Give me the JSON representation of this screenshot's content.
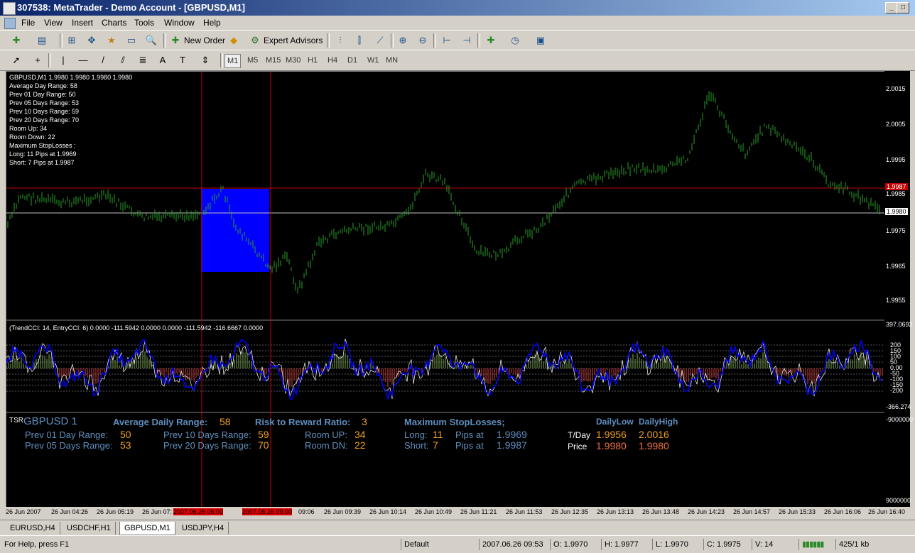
{
  "window": {
    "title": "307538: MetaTrader - Demo Account - [GBPUSD,M1]"
  },
  "menu": [
    "File",
    "View",
    "Insert",
    "Charts",
    "Tools",
    "Window",
    "Help"
  ],
  "toolbar": {
    "new_order": "New Order",
    "expert_advisors": "Expert Advisors"
  },
  "timeframes": [
    "M1",
    "M5",
    "M15",
    "M30",
    "H1",
    "H4",
    "D1",
    "W1",
    "MN"
  ],
  "chart": {
    "header": "GBPUSD,M1  1.9980 1.9980 1.9980 1.9980",
    "info_lines": [
      "Average Day  Range: 58",
      "Prev 01  Day  Range: 50",
      "Prev 05  Days Range: 53",
      "Prev 10  Days Range: 59",
      "Prev 20  Days Range: 70",
      "Room Up:    34",
      "Room Down: 22",
      "Maximum StopLosses :",
      "Long:  11 Pips at 1.9969",
      "Short: 7 Pips at 1.9987"
    ],
    "price_labels": [
      "2.0015",
      "2.0005",
      "1.9995",
      "1.9985",
      "1.9975",
      "1.9965",
      "1.9955"
    ],
    "current_price": "1.9980",
    "red_line_price": "1.9987",
    "indicator_header": "(TrendCCI: 14, EntryCCI: 6)  0.0000 -111.5942 0.0000 0.0000 -111.5942 -116.6667 0.0000",
    "cci_labels": [
      "397.0692",
      "200",
      "150",
      "100",
      "50",
      "0.00",
      "-50",
      "-100",
      "-150",
      "-200",
      "-366.274"
    ],
    "tsr_labels": [
      "-9000000",
      "9000000"
    ],
    "time_labels": [
      "26 Jun 2007",
      "26 Jun 04:26",
      "26 Jun 05:19",
      "26 Jun 07:",
      "2007.06.26 06:00",
      "2007.06.26 09:00",
      "09:06",
      "26 Jun 09:39",
      "26 Jun 10:14",
      "26 Jun 10:49",
      "26 Jun 11:21",
      "26 Jun 11:53",
      "26 Jun 12:35",
      "26 Jun 13:13",
      "26 Jun 13:48",
      "26 Jun 14:23",
      "26 Jun 14:57",
      "26 Jun 15:33",
      "26 Jun 16:06",
      "26 Jun 16:40"
    ]
  },
  "tsr": {
    "tag": "TSR",
    "symbol": "GBPUSD 1",
    "avg_label": "Average Daily Range:",
    "avg_val": "58",
    "rr_label": "Risk to Reward Ratio:",
    "rr_val": "3",
    "msl_label": "Maximum StopLosses;",
    "p01_label": "Prev 01 Day Range:",
    "p01": "50",
    "p05_label": "Prev 05 Days Range:",
    "p05": "53",
    "p10_label": "Prev 10 Days Range:",
    "p10": "59",
    "p20_label": "Prev 20 Days Range:",
    "p20": "70",
    "up_label": "Room UP:",
    "up": "34",
    "dn_label": "Room DN:",
    "dn": "22",
    "long_label": "Long:",
    "long": "11",
    "short_label": "Short:",
    "short": "7",
    "pips_at": "Pips at",
    "long_price": "1.9969",
    "short_price": "1.9987",
    "dlow": "DailyLow",
    "dhigh": "DailyHigh",
    "tday": "T/Day",
    "tday_low": "1.9956",
    "tday_high": "2.0016",
    "price": "Price",
    "price_low": "1.9980",
    "price_high": "1.9980"
  },
  "tabs": [
    "EURUSD,H4",
    "USDCHF,H1",
    "GBPUSD,M1",
    "USDJPY,H4"
  ],
  "status": {
    "help": "For Help, press F1",
    "profile": "Default",
    "time": "2007.06.26 09:53",
    "open": "O: 1.9970",
    "high": "H: 1.9977",
    "low": "L: 1.9970",
    "close": "C: 1.9975",
    "volume": "V: 14",
    "traffic": "425/1 kb"
  },
  "colors": {
    "candle": "#2aa02a",
    "trendcci": "#0000ff",
    "entrycci": "#ffffff",
    "up_hist": "#7ea85a",
    "down_hist": "#d04040",
    "box": "#0000ff",
    "orange": "#f0a020",
    "steel": "#5f8fbf"
  }
}
